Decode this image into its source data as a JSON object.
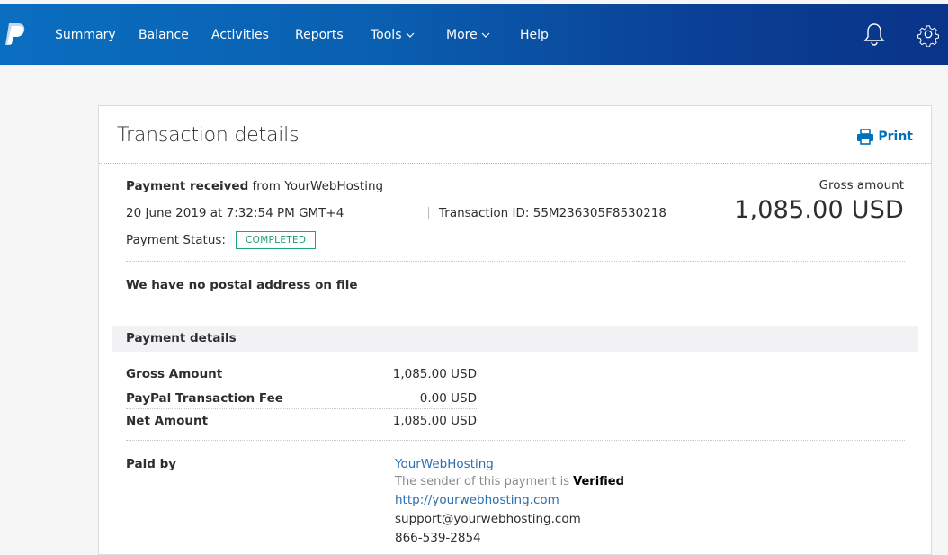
{
  "nav": {
    "logo": "paypal-logo",
    "items": [
      {
        "label": "Summary"
      },
      {
        "label": "Balance"
      },
      {
        "label": "Activities"
      },
      {
        "label": "Reports"
      },
      {
        "label": "Tools",
        "dropdown": true
      },
      {
        "label": "More",
        "dropdown": true
      },
      {
        "label": "Help"
      }
    ],
    "icons": [
      "bell-icon",
      "gear-icon"
    ]
  },
  "card": {
    "title": "Transaction details",
    "print_label": "Print",
    "payment_received": "Payment received",
    "from_text": "from YourWebHosting",
    "datetime": "20 June 2019 at 7:32:54 PM GMT+4",
    "transaction_id": "Transaction ID: 55M236305F8530218",
    "status_label": "Payment Status:",
    "status_value": "COMPLETED",
    "gross_label": "Gross amount",
    "gross_amount": "1,085.00 USD",
    "postal_note": "We have no postal address on file"
  },
  "payment_details": {
    "heading": "Payment details",
    "rows": [
      {
        "label": "Gross Amount",
        "value": "1,085.00 USD"
      },
      {
        "label": "PayPal Transaction Fee",
        "value": "0.00 USD"
      },
      {
        "label": "Net Amount",
        "value": "1,085.00 USD"
      }
    ]
  },
  "paid_by": {
    "label": "Paid by",
    "name": "YourWebHosting",
    "verified_prefix": "The sender of this payment is",
    "verified_word": "Verified",
    "website": "http://yourwebhosting.com",
    "email": "support@yourwebhosting.com",
    "phone": "866-539-2854"
  },
  "colors": {
    "nav_gradient_start": "#0a6ec0",
    "nav_gradient_end": "#093488",
    "link": "#2a6fb0",
    "status_green": "#1f9b6f"
  }
}
